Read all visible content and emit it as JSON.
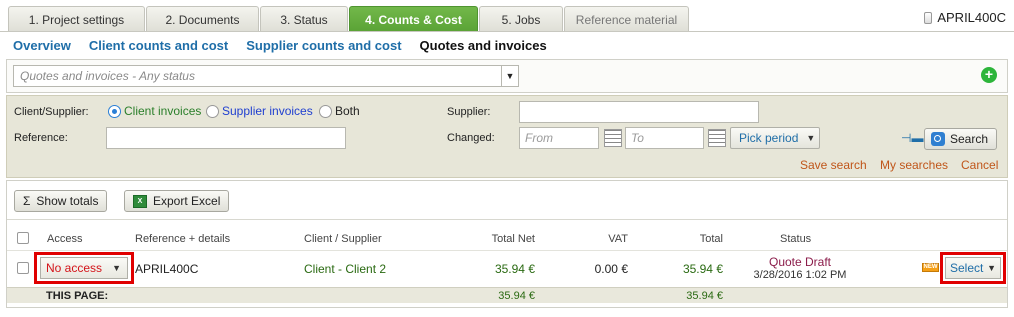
{
  "tabs": [
    {
      "label": "1. Project settings"
    },
    {
      "label": "2. Documents"
    },
    {
      "label": "3. Status"
    },
    {
      "label": "4. Counts & Cost"
    },
    {
      "label": "5. Jobs"
    },
    {
      "label": "Reference material"
    }
  ],
  "project_id": "APRIL400C",
  "subnav": [
    "Overview",
    "Client counts and cost",
    "Supplier counts and cost",
    "Quotes and invoices"
  ],
  "status_filter": {
    "placeholder": "Quotes and invoices - Any status"
  },
  "search": {
    "client_supplier_label": "Client/Supplier:",
    "radio_options": [
      "Client invoices",
      "Supplier invoices",
      "Both"
    ],
    "reference_label": "Reference:",
    "supplier_label": "Supplier:",
    "changed_label": "Changed:",
    "from_placeholder": "From",
    "to_placeholder": "To",
    "pick_period": "Pick period",
    "search_button": "Search",
    "save_search": "Save search",
    "my_searches": "My searches",
    "cancel": "Cancel"
  },
  "toolbar": {
    "show_totals": "Show totals",
    "export_excel": "Export Excel"
  },
  "table": {
    "headers": {
      "access": "Access",
      "reference": "Reference + details",
      "client_supplier": "Client / Supplier",
      "total_net": "Total Net",
      "vat": "VAT",
      "total": "Total",
      "status": "Status"
    },
    "row": {
      "access": "No access",
      "reference": "APRIL400C",
      "client_supplier": "Client - Client 2",
      "total_net": "35.94 €",
      "vat": "0.00 €",
      "total": "35.94 €",
      "status": "Quote Draft",
      "status_date": "3/28/2016 1:02 PM",
      "badge": "NEW",
      "select": "Select"
    },
    "totals": {
      "label": "THIS PAGE:",
      "total_net": "35.94 €",
      "total": "35.94 €"
    }
  },
  "colors": {
    "active_tab": "#5aa235",
    "link": "#1f6ea8",
    "danger": "#d4141a",
    "highlight_frame": "#e00000"
  }
}
